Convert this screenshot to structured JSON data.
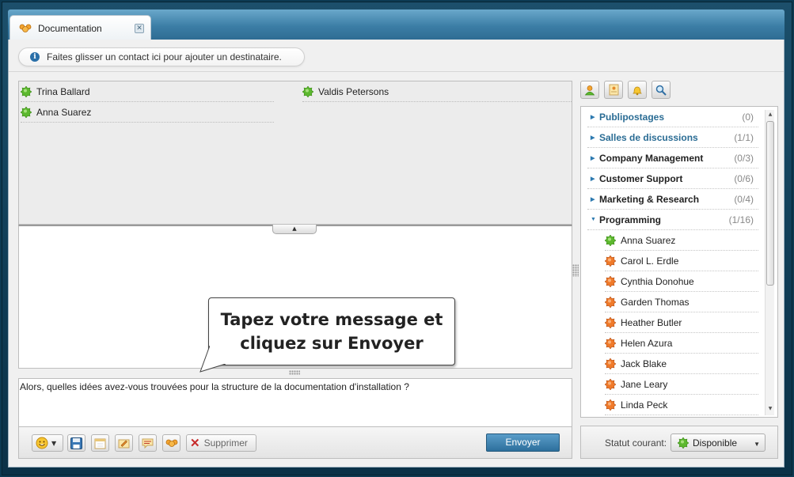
{
  "tab": {
    "label": "Documentation",
    "close_glyph": "✕"
  },
  "infobar": {
    "text": "Faites glisser un contact ici pour ajouter un destinataire."
  },
  "recipients": [
    {
      "name": "Trina Ballard",
      "status": "online"
    },
    {
      "name": "Valdis Petersons",
      "status": "online"
    },
    {
      "name": "Anna Suarez",
      "status": "online"
    }
  ],
  "tooltip": {
    "line1": "Tapez votre message et",
    "line2": "cliquez sur Envoyer"
  },
  "compose": {
    "text": "Alors, quelles idées avez-vous trouvées pour la structure de la documentation d'installation ?"
  },
  "toolbar": {
    "delete_label": "Supprimer",
    "send_label": "Envoyer"
  },
  "groups": [
    {
      "name": "Publipostages",
      "count": "(0)",
      "expanded": false,
      "color": "#2a6c94"
    },
    {
      "name": "Salles de discussions",
      "count": "(1/1)",
      "expanded": false,
      "color": "#2a6c94"
    },
    {
      "name": "Company Management",
      "count": "(0/3)",
      "expanded": false,
      "color": "#222222"
    },
    {
      "name": "Customer Support",
      "count": "(0/6)",
      "expanded": false,
      "color": "#222222"
    },
    {
      "name": "Marketing & Research",
      "count": "(0/4)",
      "expanded": false,
      "color": "#222222"
    },
    {
      "name": "Programming",
      "count": "(1/16)",
      "expanded": true,
      "color": "#222222"
    }
  ],
  "members": [
    {
      "name": "Anna Suarez",
      "status": "online"
    },
    {
      "name": "Carol L. Erdle",
      "status": "offline"
    },
    {
      "name": "Cynthia Donohue",
      "status": "offline"
    },
    {
      "name": "Garden Thomas",
      "status": "offline"
    },
    {
      "name": "Heather Butler",
      "status": "offline"
    },
    {
      "name": "Helen Azura",
      "status": "offline"
    },
    {
      "name": "Jack Blake",
      "status": "offline"
    },
    {
      "name": "Jane Leary",
      "status": "offline"
    },
    {
      "name": "Linda Peck",
      "status": "offline"
    }
  ],
  "status": {
    "label": "Statut courant:",
    "value": "Disponible"
  },
  "colors": {
    "online": "#5cb82e",
    "offline": "#f07a2a",
    "accent": "#3a7fae"
  }
}
